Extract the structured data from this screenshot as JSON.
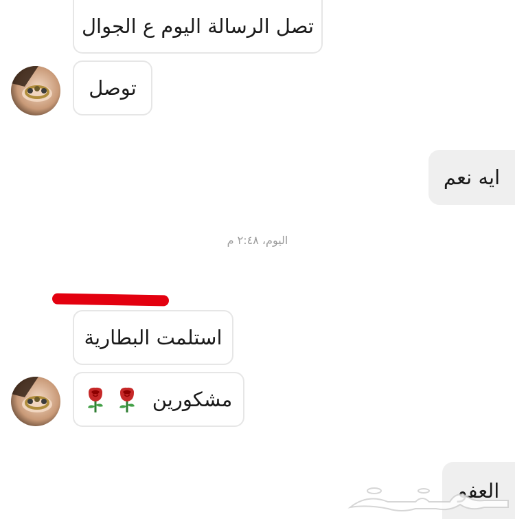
{
  "messages": {
    "m1": "تصل الرسالة اليوم ع الجوال",
    "m2": "توصل",
    "m3": "ايه نعم",
    "m4": "استلمت البطارية",
    "m5": "مشكورين",
    "m6": "العفو"
  },
  "timestamp": "اليوم، ٢:٤٨ م",
  "icons": {
    "avatar": "avatar-ring-photo",
    "rose": "rose-emoji",
    "watermark": "haraj-logo"
  },
  "colors": {
    "incoming_border": "#e6e6e6",
    "outgoing_bg": "#efefef",
    "redaction": "#e3000f"
  }
}
